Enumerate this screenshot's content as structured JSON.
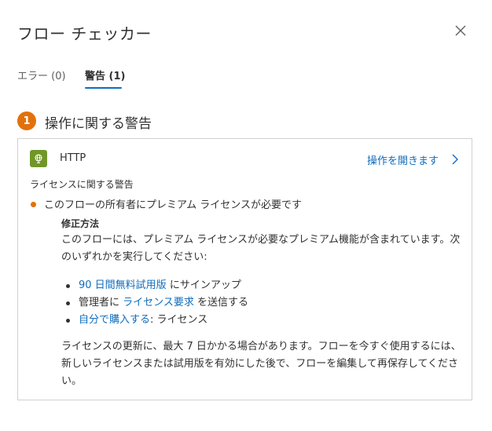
{
  "dialog": {
    "title": "フロー チェッカー",
    "close_icon": "close-icon"
  },
  "tabs": [
    {
      "label": "エラー (0)",
      "active": false
    },
    {
      "label": "警告 (1)",
      "active": true
    }
  ],
  "section": {
    "count": "1",
    "title": "操作に関する警告"
  },
  "card": {
    "action_icon": "globe-icon",
    "action_name": "HTTP",
    "open_link": "操作を開きます",
    "category": "ライセンスに関する警告",
    "warning_text": "このフローの所有者にプレミアム ライセンスが必要です",
    "fix": {
      "title": "修正方法",
      "description": "このフローには、プレミアム ライセンスが必要なプレミアム機能が含まれています。次のいずれかを実行してください:",
      "options": [
        {
          "link": "90 日間無料試用版",
          "suffix": " にサインアップ",
          "prefix": ""
        },
        {
          "prefix": "管理者に ",
          "link": "ライセンス要求",
          "suffix": " を送信する"
        },
        {
          "prefix": "",
          "link": "自分で購入する",
          "suffix": ": ライセンス"
        }
      ],
      "note": "ライセンスの更新に、最大 7 日かかる場合があります。フローを今すぐ使用するには、新しいライセンスまたは試用版を有効にした後で、フローを編集して再保存してください。"
    }
  },
  "colors": {
    "accent": "#0f6cbd",
    "badge": "#e3710b",
    "warning_dot": "#e3710b",
    "http_icon_bg": "#709727"
  }
}
